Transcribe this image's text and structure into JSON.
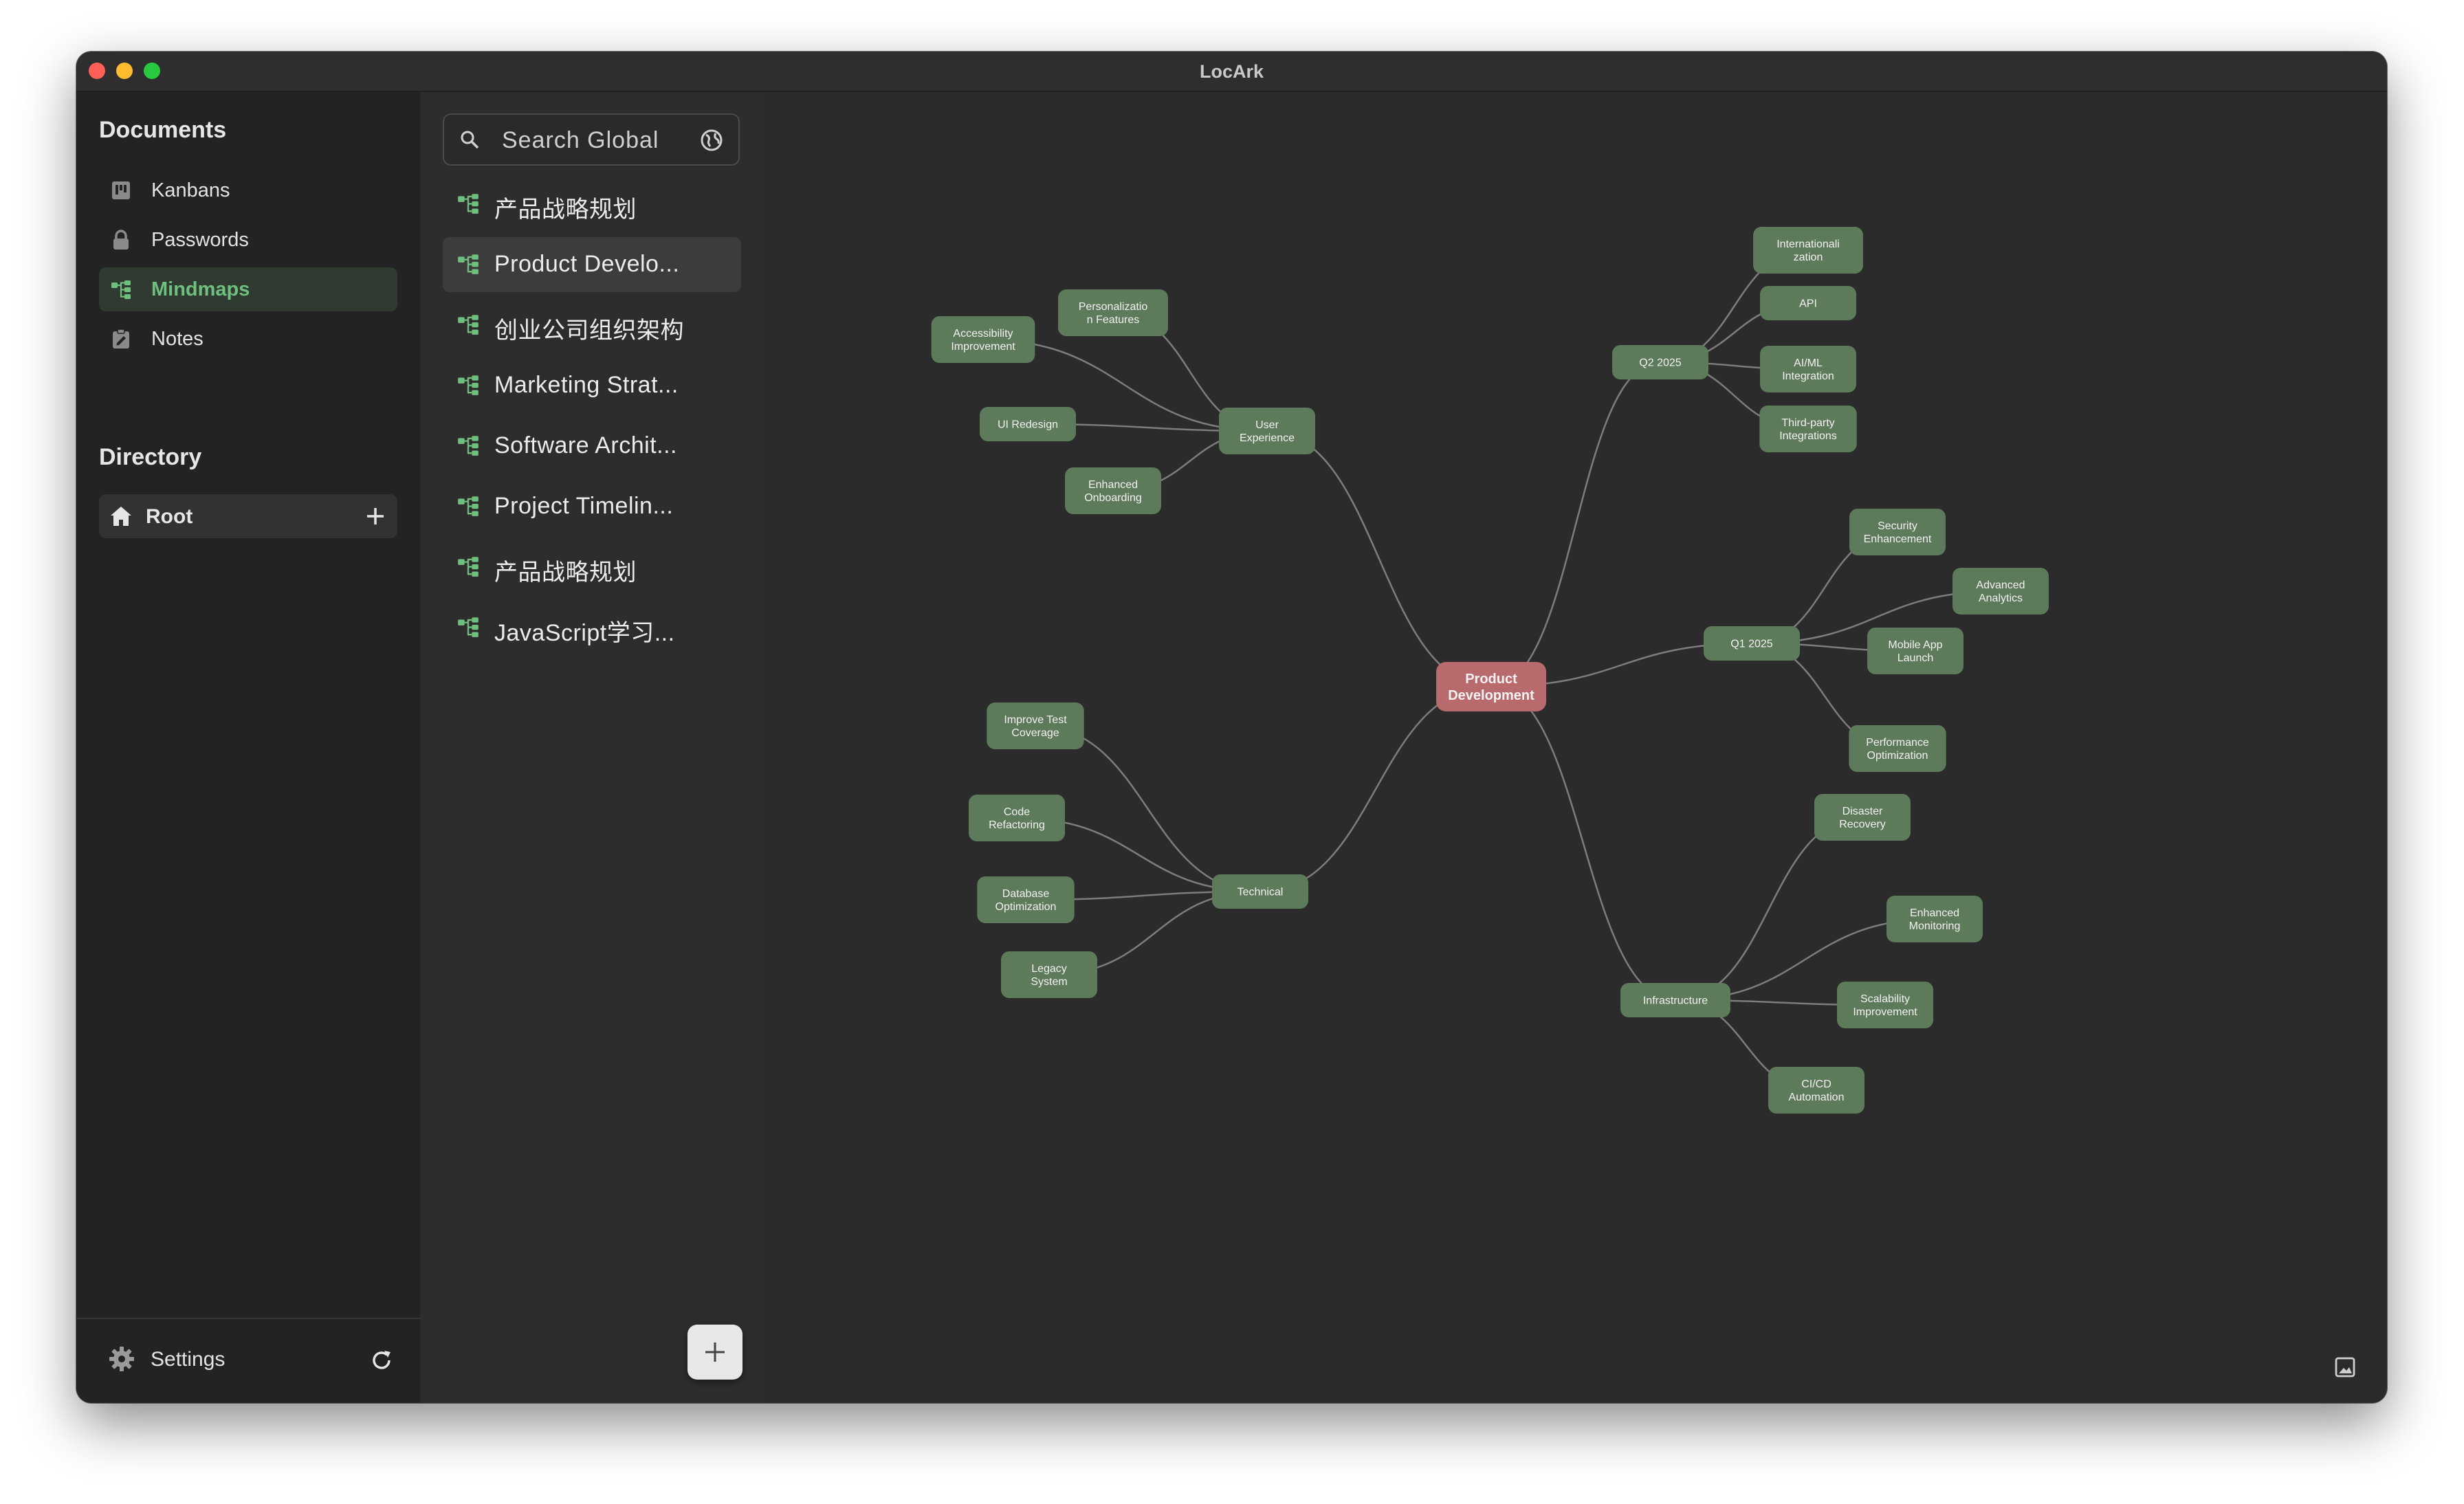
{
  "window": {
    "title": "LocArk"
  },
  "sidebar": {
    "documents_title": "Documents",
    "items": [
      {
        "label": "Kanbans",
        "icon": "kanban-icon"
      },
      {
        "label": "Passwords",
        "icon": "lock-icon"
      },
      {
        "label": "Mindmaps",
        "icon": "mindmap-icon",
        "active": true
      },
      {
        "label": "Notes",
        "icon": "notes-icon"
      }
    ],
    "directory_title": "Directory",
    "root_label": "Root",
    "settings_label": "Settings"
  },
  "list": {
    "search_placeholder": "Search Global",
    "items": [
      {
        "label": "产品战略规划"
      },
      {
        "label": "Product Develo...",
        "active": true
      },
      {
        "label": "创业公司组织架构"
      },
      {
        "label": "Marketing Strat..."
      },
      {
        "label": "Software Archit..."
      },
      {
        "label": "Project Timelin..."
      },
      {
        "label": "产品战略规划"
      },
      {
        "label": "JavaScript学习..."
      }
    ]
  },
  "mindmap": {
    "root": {
      "id": "root",
      "lines": [
        "Product",
        "Development"
      ]
    },
    "nodes": [
      {
        "id": "ux",
        "parent": "root",
        "lines": [
          "User",
          "Experience"
        ]
      },
      {
        "id": "ux1",
        "parent": "ux",
        "lines": [
          "Accessibility",
          "Improvement"
        ]
      },
      {
        "id": "ux2",
        "parent": "ux",
        "lines": [
          "Personalizatio",
          "n Features"
        ]
      },
      {
        "id": "ux3",
        "parent": "ux",
        "lines": [
          "UI Redesign"
        ]
      },
      {
        "id": "ux4",
        "parent": "ux",
        "lines": [
          "Enhanced",
          "Onboarding"
        ]
      },
      {
        "id": "tech",
        "parent": "root",
        "lines": [
          "Technical"
        ]
      },
      {
        "id": "t1",
        "parent": "tech",
        "lines": [
          "Improve Test",
          "Coverage"
        ]
      },
      {
        "id": "t2",
        "parent": "tech",
        "lines": [
          "Code",
          "Refactoring"
        ]
      },
      {
        "id": "t3",
        "parent": "tech",
        "lines": [
          "Database",
          "Optimization"
        ]
      },
      {
        "id": "t4",
        "parent": "tech",
        "lines": [
          "Legacy",
          "System"
        ]
      },
      {
        "id": "q2",
        "parent": "root",
        "lines": [
          "Q2 2025"
        ]
      },
      {
        "id": "q2a",
        "parent": "q2",
        "lines": [
          "Internationali",
          "zation"
        ]
      },
      {
        "id": "q2b",
        "parent": "q2",
        "lines": [
          "API"
        ]
      },
      {
        "id": "q2c",
        "parent": "q2",
        "lines": [
          "AI/ML",
          "Integration"
        ]
      },
      {
        "id": "q2d",
        "parent": "q2",
        "lines": [
          "Third-party",
          "Integrations"
        ]
      },
      {
        "id": "q1",
        "parent": "root",
        "lines": [
          "Q1 2025"
        ]
      },
      {
        "id": "q1a",
        "parent": "q1",
        "lines": [
          "Security",
          "Enhancement"
        ]
      },
      {
        "id": "q1b",
        "parent": "q1",
        "lines": [
          "Advanced",
          "Analytics"
        ]
      },
      {
        "id": "q1c",
        "parent": "q1",
        "lines": [
          "Mobile App",
          "Launch"
        ]
      },
      {
        "id": "q1d",
        "parent": "q1",
        "lines": [
          "Performance",
          "Optimization"
        ]
      },
      {
        "id": "inf",
        "parent": "root",
        "lines": [
          "Infrastructure"
        ]
      },
      {
        "id": "i1",
        "parent": "inf",
        "lines": [
          "Disaster",
          "Recovery"
        ]
      },
      {
        "id": "i2",
        "parent": "inf",
        "lines": [
          "Enhanced",
          "Monitoring"
        ]
      },
      {
        "id": "i3",
        "parent": "inf",
        "lines": [
          "Scalability",
          "Improvement"
        ]
      },
      {
        "id": "i4",
        "parent": "inf",
        "lines": [
          "CI/CD",
          "Automation"
        ]
      }
    ]
  },
  "colors": {
    "node_fill": "#5d7a5a",
    "root_fill": "#b86a6c",
    "edge": "#7d7d7d",
    "accent": "#6fbf7e"
  }
}
